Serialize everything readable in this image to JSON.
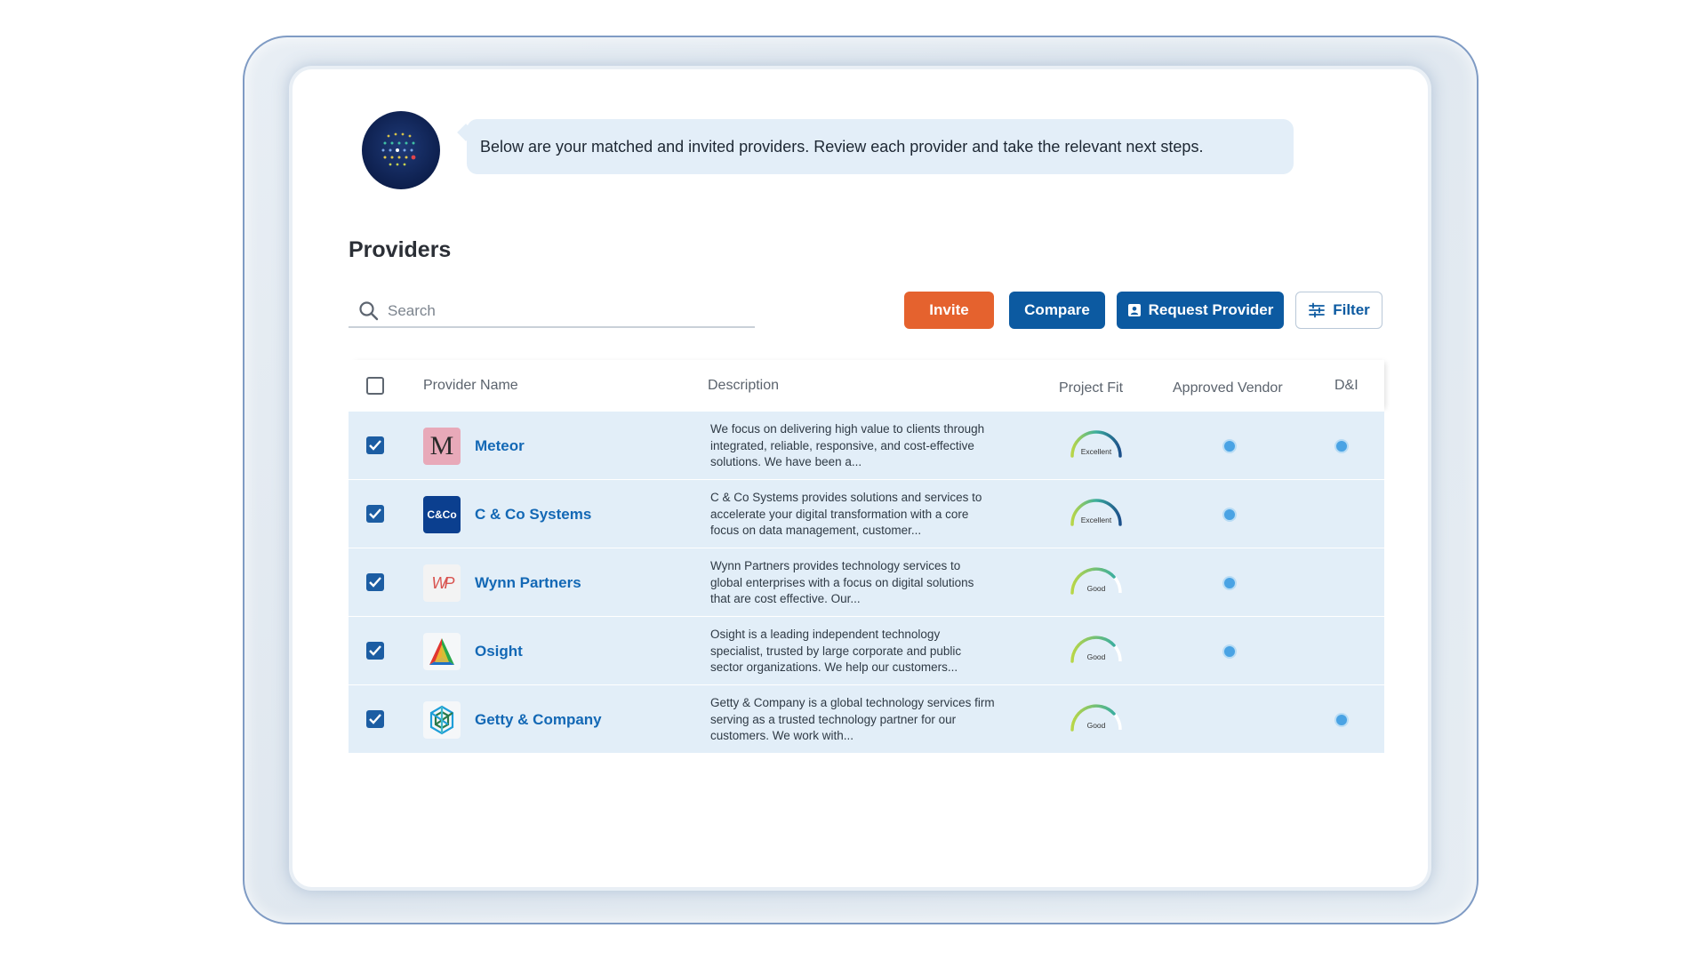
{
  "assistant": {
    "message": "Below are your matched and invited providers. Review each provider and take the relevant next steps."
  },
  "page": {
    "title": "Providers"
  },
  "search": {
    "placeholder": "Search"
  },
  "toolbar": {
    "invite_label": "Invite",
    "compare_label": "Compare",
    "request_label": "Request Provider",
    "filter_label": "Filter"
  },
  "table": {
    "headers": {
      "name": "Provider Name",
      "description": "Description",
      "project_fit": "Project Fit",
      "approved_vendor": "Approved Vendor",
      "dni": "D&I"
    },
    "rows": [
      {
        "name": "Meteor",
        "logo_text": "M",
        "description": "We focus on delivering high value to clients through integrated, reliable, responsive, and cost-effective solutions. We have been a...",
        "fit": "Excellent",
        "approved": true,
        "dni": true,
        "checked": true
      },
      {
        "name": "C & Co Systems",
        "logo_text": "C&Co",
        "description": "C & Co Systems provides solutions and services to accelerate your digital transformation with a core focus on data management, customer...",
        "fit": "Excellent",
        "approved": true,
        "dni": false,
        "checked": true
      },
      {
        "name": "Wynn Partners",
        "logo_text": "WP",
        "description": "Wynn Partners provides technology services to global enterprises with a focus on digital solutions that are cost effective. Our...",
        "fit": "Good",
        "approved": true,
        "dni": false,
        "checked": true
      },
      {
        "name": "Osight",
        "logo_text": "",
        "description": "Osight is a leading independent technology specialist, trusted by large corporate and public sector organizations. We help our customers...",
        "fit": "Good",
        "approved": true,
        "dni": false,
        "checked": true
      },
      {
        "name": "Getty & Company",
        "logo_text": "",
        "description": "Getty & Company is a global technology services firm serving as a trusted technology partner for our customers. We work with...",
        "fit": "Good",
        "approved": false,
        "dni": true,
        "checked": true
      }
    ]
  },
  "colors": {
    "accent": "#0c5aa1",
    "invite": "#e5622e",
    "row_bg": "#e2eef8",
    "link": "#1368b5",
    "status_dot": "#4aa3e4"
  },
  "icons": {
    "search": "search-icon",
    "filter": "sliders-icon",
    "request": "user-badge-icon",
    "avatar": "assistant-dots-icon"
  }
}
